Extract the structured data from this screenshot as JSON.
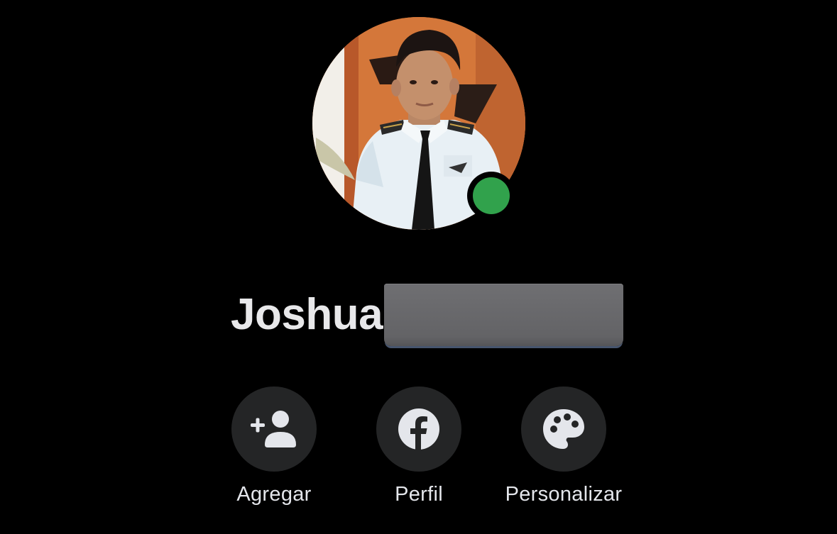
{
  "profile": {
    "first_name": "Joshua",
    "last_name_redacted": true,
    "online": true,
    "presence_color": "#31a24c"
  },
  "actions": [
    {
      "label": "Agregar",
      "icon": "add-person-icon"
    },
    {
      "label": "Perfil",
      "icon": "facebook-icon"
    },
    {
      "label": "Personalizar",
      "icon": "palette-icon"
    }
  ],
  "colors": {
    "background": "#000000",
    "action_circle": "#242526",
    "text": "#e4e6eb"
  }
}
